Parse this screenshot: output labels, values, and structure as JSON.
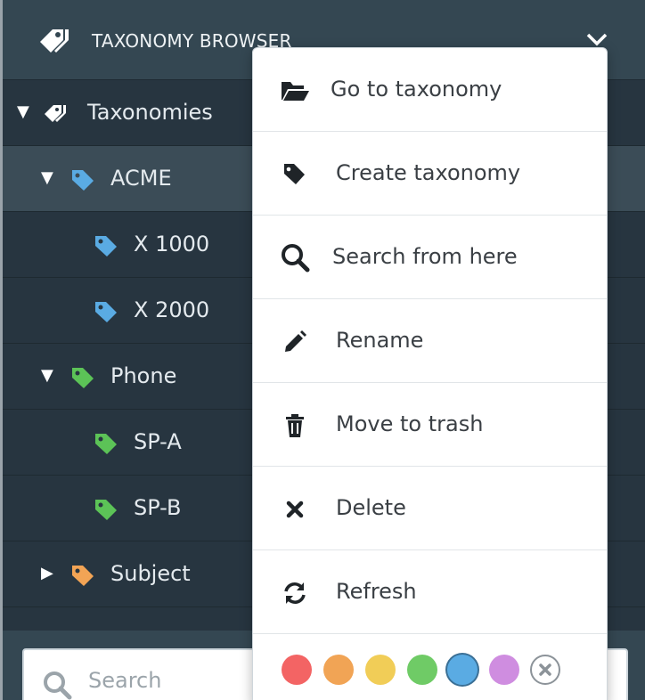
{
  "header": {
    "title": "TAXONOMY BROWSER",
    "icon": "tags-icon",
    "chevron": "chevron-down-icon"
  },
  "tree": {
    "root": {
      "label": "Taxonomies"
    },
    "items": [
      {
        "label": "ACME",
        "color": "#5aabe3",
        "expanded": true,
        "selected": true
      },
      {
        "label": "X 1000",
        "color": "#5aabe3"
      },
      {
        "label": "X 2000",
        "color": "#5aabe3"
      },
      {
        "label": "Phone",
        "color": "#5cc357",
        "expanded": true
      },
      {
        "label": "SP-A",
        "color": "#5cc357"
      },
      {
        "label": "SP-B",
        "color": "#5cc357"
      },
      {
        "label": "Subject",
        "color": "#f2a455",
        "expanded": false
      }
    ]
  },
  "search": {
    "placeholder": "Search"
  },
  "menu": {
    "items": [
      {
        "label": "Go to taxonomy",
        "icon": "folder-open-icon"
      },
      {
        "label": "Create taxonomy",
        "icon": "tag-icon"
      },
      {
        "label": "Search from here",
        "icon": "search-icon"
      },
      {
        "label": "Rename",
        "icon": "pencil-icon"
      },
      {
        "label": "Move to trash",
        "icon": "trash-icon"
      },
      {
        "label": "Delete",
        "icon": "close-icon"
      },
      {
        "label": "Refresh",
        "icon": "refresh-icon"
      }
    ],
    "colors": [
      "#f36464",
      "#f1a455",
      "#f1cd57",
      "#6fcb66",
      "#5aabe3",
      "#cf8de0"
    ],
    "selected_color": "#5aabe3"
  }
}
